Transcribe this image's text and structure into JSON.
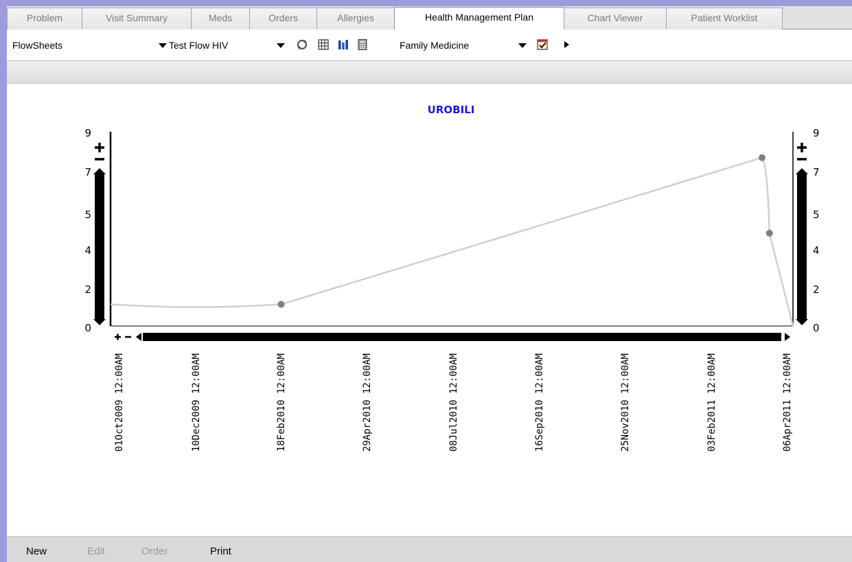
{
  "tabs": [
    {
      "label": "Problem"
    },
    {
      "label": "Visit Summary"
    },
    {
      "label": "Meds"
    },
    {
      "label": "Orders"
    },
    {
      "label": "Allergies"
    },
    {
      "label": "Health Management Plan",
      "active": true
    },
    {
      "label": "Chart Viewer"
    },
    {
      "label": "Patient Worklist"
    }
  ],
  "toolbar": {
    "view_select": "FlowSheets",
    "flowsheet_select": "Test Flow HIV",
    "specialty_select": "Family Medicine",
    "icons": [
      "refresh-icon",
      "table-icon",
      "bar-chart-icon",
      "calculator-icon",
      "checklist-icon",
      "play-arrow-icon"
    ]
  },
  "bottom": {
    "new_label": "New",
    "edit_label": "Edit",
    "order_label": "Order",
    "print_label": "Print"
  },
  "chart_data": {
    "type": "line",
    "title": "UROBILI",
    "xlabel": "",
    "ylabel": "",
    "yticks": [
      "0",
      "2",
      "4",
      "5",
      "7",
      "9"
    ],
    "ylim": [
      0,
      9
    ],
    "xticks": [
      "01Oct2009 12:00AM",
      "10Dec2009 12:00AM",
      "18Feb2010 12:00AM",
      "29Apr2010 12:00AM",
      "08Jul2010 12:00AM",
      "16Sep2010 12:00AM",
      "25Nov2010 12:00AM",
      "03Feb2011 12:00AM",
      "06Apr2011 12:00AM"
    ],
    "xlim": [
      "2009-10-01",
      "2011-04-06"
    ],
    "grid": false,
    "series": [
      {
        "points": [
          {
            "x": "2010-02-16",
            "y": 1,
            "marker": true
          },
          {
            "x": "2011-03-12",
            "y": 7.8,
            "marker": true
          },
          {
            "x": "2011-03-18",
            "y": 4.3,
            "marker": true
          },
          {
            "x": "2011-04-06",
            "y": 0,
            "marker": false
          }
        ],
        "start_value": 1,
        "color": "#cfcfcf",
        "marker_color": "#808080"
      }
    ]
  }
}
